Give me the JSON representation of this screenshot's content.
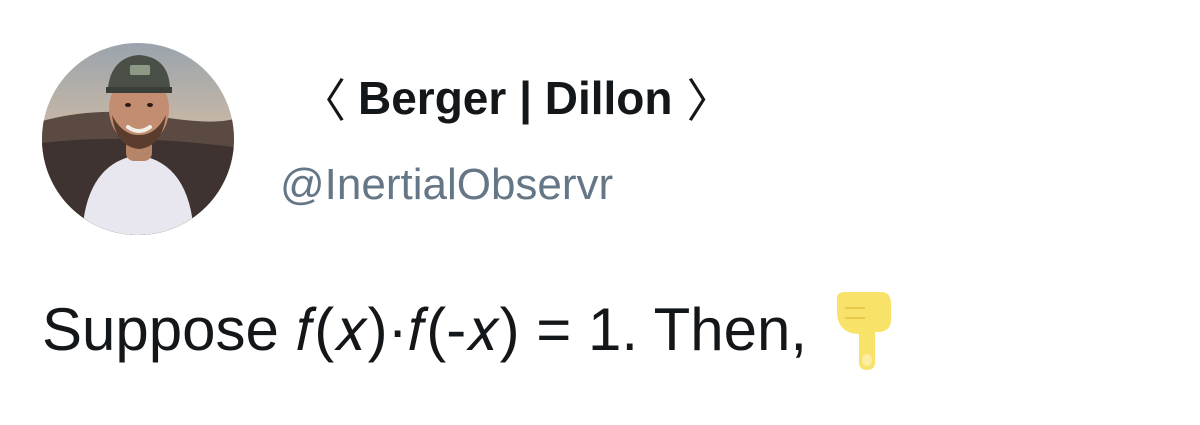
{
  "tweet": {
    "author": {
      "display_name": "Berger | Dillon",
      "bracket_left": "〈",
      "bracket_right": "〉",
      "handle": "@InertialObservr"
    },
    "text": "Suppose 𝑓(𝑥)·𝑓(-𝑥) = 1. Then,",
    "emoji": "backhand-index-pointing-down"
  },
  "colors": {
    "name": "#14171a",
    "handle": "#657786",
    "text": "#14171a",
    "emoji": "#f9e26a"
  }
}
